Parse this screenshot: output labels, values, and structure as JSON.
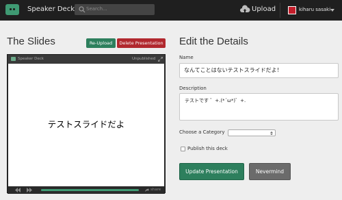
{
  "header": {
    "brand": "Speaker Deck",
    "search_placeholder": "Search...",
    "upload_label": "Upload",
    "username": "kiharu sasaki"
  },
  "slides": {
    "title": "The Slides",
    "reupload_label": "Re-Upload",
    "delete_label": "Delete Presentation",
    "player": {
      "brand": "Speaker Deck",
      "status": "Unpublished",
      "slide_text": "テストスライドだよ",
      "progress": 1.0,
      "share_label": "share"
    }
  },
  "details": {
    "title": "Edit the Details",
    "name_label": "Name",
    "name_value": "なんてことはないテストスライドだよ！",
    "description_label": "Description",
    "description_value": "テストです ゛+.(*´ω*)゛+.",
    "category_label": "Choose a Category",
    "category_value": "",
    "publish_label": "Publish this deck",
    "publish_checked": false,
    "update_label": "Update Presentation",
    "nevermind_label": "Nevermind"
  },
  "colors": {
    "topbar": "#1f1f1f",
    "green": "#2d7f5d",
    "red": "#b1282e",
    "grey_button": "#6b6b6b"
  },
  "icons": [
    "speaker-deck-logo-icon",
    "search-icon",
    "cloud-upload-icon",
    "chevron-down-icon",
    "expand-icon",
    "prev-icon",
    "next-icon",
    "share-icon",
    "select-arrow-icon"
  ]
}
